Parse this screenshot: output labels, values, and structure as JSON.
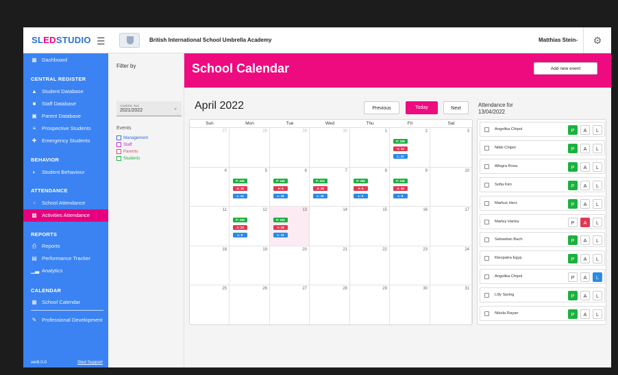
{
  "header": {
    "logo_main": "SL",
    "logo_accent": "ED",
    "logo_rest": "STUDIO",
    "school_name": "British International School Umbrella Academy",
    "user_name": "Matthias Stein"
  },
  "sidebar": {
    "dashboard": "Dashboard",
    "central_register": "CENTRAL REGISTER",
    "student_db": "Student Database",
    "staff_db": "Staff Database",
    "parent_db": "Parent Database",
    "prospective": "Prospective Students",
    "emergency": "Emergency Students",
    "behavior": "BEHAVIOR",
    "student_behaviour": "Student Behaviour",
    "attendance": "ATTENDANCE",
    "school_attendance": "School Attendance",
    "activities_attendance": "Activities Attendance",
    "reports_head": "REPORTS",
    "reports": "Reports",
    "performance": "Performance Tracker",
    "analytics": "Analytics",
    "calendar_head": "CALENDAR",
    "school_calendar": "School Calendar",
    "professional_dev": "Professional Development",
    "version": "ver6.0.0",
    "support": "Sled Support"
  },
  "filter": {
    "title": "Filter by",
    "academic_year_label": "Academic Year",
    "academic_year": "2021/2022",
    "events_title": "Events",
    "events": [
      {
        "label": "Management",
        "color": "#2a6fd6"
      },
      {
        "label": "Staff",
        "color": "#c02ad0"
      },
      {
        "label": "Parents",
        "color": "#e8407a"
      },
      {
        "label": "Students",
        "color": "#1bb13f"
      }
    ]
  },
  "main": {
    "title": "School Calendar",
    "add_event": "Add new event",
    "month": "April 2022",
    "previous": "Previous",
    "today": "Today",
    "next": "Next"
  },
  "calendar": {
    "weekdays": [
      "Sun",
      "Mon",
      "Tue",
      "Wed",
      "Thu",
      "Fri",
      "Sat"
    ],
    "weeks": [
      [
        {
          "d": "27",
          "dim": true
        },
        {
          "d": "28",
          "dim": true
        },
        {
          "d": "29",
          "dim": true
        },
        {
          "d": "30",
          "dim": true
        },
        {
          "d": "1"
        },
        {
          "d": "2",
          "p": "P: 236",
          "a": "A: 12",
          "l": "L: 12"
        },
        {
          "d": "3"
        }
      ],
      [
        {
          "d": "4"
        },
        {
          "d": "5",
          "p": "P: 236",
          "a": "A: 10",
          "l": "L: 14"
        },
        {
          "d": "6",
          "p": "P: 240",
          "a": "A: 5",
          "l": "L: 15"
        },
        {
          "d": "7",
          "p": "P: 220",
          "a": "A: 25",
          "l": "L: 15"
        },
        {
          "d": "8",
          "p": "P: 255",
          "a": "A: 5",
          "l": "L: 0"
        },
        {
          "d": "9",
          "p": "P: 236",
          "a": "A: 16",
          "l": "L: 8"
        },
        {
          "d": "10"
        }
      ],
      [
        {
          "d": "11"
        },
        {
          "d": "12",
          "p": "P: 239",
          "a": "A: 23",
          "l": "L: 8"
        },
        {
          "d": "13",
          "today": true,
          "p": "P: 232",
          "a": "A: 26",
          "l": "L: 12"
        },
        {
          "d": "14"
        },
        {
          "d": "15"
        },
        {
          "d": "16"
        },
        {
          "d": "17"
        }
      ],
      [
        {
          "d": "18"
        },
        {
          "d": "19"
        },
        {
          "d": "20"
        },
        {
          "d": "21"
        },
        {
          "d": "22"
        },
        {
          "d": "23"
        },
        {
          "d": "24"
        }
      ],
      [
        {
          "d": "25"
        },
        {
          "d": "26"
        },
        {
          "d": "27"
        },
        {
          "d": "28"
        },
        {
          "d": "29"
        },
        {
          "d": "30"
        },
        {
          "d": "31"
        }
      ]
    ]
  },
  "attendance": {
    "title_line1": "Attendance for",
    "title_line2": "13/04/2022",
    "labels": {
      "p": "P",
      "a": "A",
      "l": "L"
    },
    "students": [
      {
        "name": "Angelika Chipol",
        "status": "P"
      },
      {
        "name": "Nikki Chipol",
        "status": "P"
      },
      {
        "name": "Allegra Rosa",
        "status": "P"
      },
      {
        "name": "Sofia Kim",
        "status": "P"
      },
      {
        "name": "Markus Herz",
        "status": "P"
      },
      {
        "name": "Marley Harley",
        "status": "A"
      },
      {
        "name": "Sebastian Bach",
        "status": "P"
      },
      {
        "name": "Kleopatra Egyp",
        "status": "P"
      },
      {
        "name": "Angelika Chipol",
        "status": "L"
      },
      {
        "name": "Lilly Spring",
        "status": "P"
      },
      {
        "name": "Nikola Rayan",
        "status": "P"
      }
    ]
  }
}
